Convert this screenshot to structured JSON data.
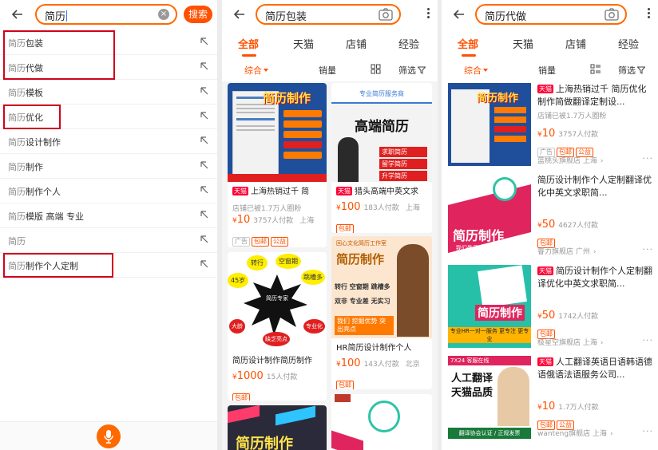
{
  "panel1": {
    "query": "简历",
    "search_button": "搜索",
    "clear_icon": "clear-icon",
    "suggestions": [
      {
        "prefix": "简历",
        "rest": "包装",
        "boxed": true
      },
      {
        "prefix": "简历",
        "rest": "代做",
        "boxed": true
      },
      {
        "prefix": "简历",
        "rest": "模板",
        "boxed": false
      },
      {
        "prefix": "简历",
        "rest": "优化",
        "boxed": true
      },
      {
        "prefix": "简历",
        "rest": "设计制作",
        "boxed": false
      },
      {
        "prefix": "简历",
        "rest": "制作",
        "boxed": false
      },
      {
        "prefix": "简历",
        "rest": "制作个人",
        "boxed": false
      },
      {
        "prefix": "简历",
        "rest": "模版 高端 专业",
        "boxed": false
      },
      {
        "prefix": "简历",
        "rest": "",
        "boxed": false
      },
      {
        "prefix": "简历",
        "rest": "制作个人定制",
        "boxed": true
      }
    ],
    "voice_icon": "microphone-icon"
  },
  "panel2": {
    "query": "简历包装",
    "tabs": [
      "全部",
      "天猫",
      "店铺",
      "经验"
    ],
    "filters": {
      "sort": "综合",
      "sales": "销量",
      "filter": "筛选"
    },
    "cards": [
      {
        "title": "上海热销过千 简",
        "tmall": "天猫",
        "sub": "店铺已被1.7万人圈粉",
        "price": "10",
        "paid": "3757人付款",
        "loc": "上海",
        "tags": [
          "广告",
          "包邮",
          "公益"
        ],
        "img_text": "简历制作"
      },
      {
        "title": "猎头高端中英文求",
        "tmall": "天猫",
        "sub": "",
        "price": "100",
        "paid": "183人付款",
        "loc": "上海",
        "tags": [
          "包邮"
        ],
        "img_text": "高端简历",
        "img_lines": [
          "求职简历",
          "留学简历",
          "升学简历"
        ],
        "img_top": "专业简历服务商"
      },
      {
        "title": "简历设计制作简历制作",
        "tmall": "",
        "sub": "",
        "price": "1000",
        "paid": "15人付款",
        "loc": "",
        "tags": [
          "包邮"
        ],
        "img_words": [
          "转行",
          "空窗期",
          "45岁",
          "跳槽多",
          "简历专家",
          "专业化",
          "大龄",
          "缺乏亮点"
        ]
      },
      {
        "title": "HR简历设计制作个人",
        "tmall": "",
        "sub": "",
        "price": "100",
        "paid": "143人付款",
        "loc": "北京",
        "tags": [
          "包邮"
        ],
        "img_text": "简历制作",
        "img_lines": [
          "转行 空窗期 跳槽多",
          "双非 专业差 无实习",
          "我们 挖掘优势 突出亮点"
        ],
        "img_top": "回心文化简历工作室"
      },
      {
        "title": "",
        "tmall": "",
        "sub": "",
        "price": "",
        "paid": "",
        "loc": "",
        "tags": [],
        "img_text": "简历制作"
      },
      {
        "title": "",
        "tmall": "",
        "sub": "",
        "price": "",
        "paid": "",
        "loc": "",
        "tags": [],
        "img_text": ""
      }
    ]
  },
  "panel3": {
    "query": "简历代做",
    "tabs": [
      "全部",
      "天猫",
      "店铺",
      "经验"
    ],
    "filters": {
      "sort": "综合",
      "sales": "销量",
      "filter": "筛选"
    },
    "rows": [
      {
        "tmall": "天猫",
        "title": "上海热销过千 简历优化制作简做翻译定制设...",
        "sub": "店铺已被1.7万人圈粉",
        "price": "10",
        "paid": "3757人付款",
        "tags": [
          "广告",
          "包邮",
          "公益"
        ],
        "shop": "蓝桃头旗舰店 上海",
        "img_text": "简历制作"
      },
      {
        "tmall": "",
        "title": "简历设计制作个人定制翻译优化中英文求职简...",
        "sub": "",
        "price": "50",
        "paid": "4627人付款",
        "tags": [
          "包邮"
        ],
        "shop": "睿力旗舰店 广州",
        "img_text": "简历制作",
        "img_sub": "我们骨子里是HR, 不是商人"
      },
      {
        "tmall": "天猫",
        "title": "简历设计制作个人定制翻译优化中英文求职简...",
        "sub": "",
        "price": "50",
        "paid": "1742人付款",
        "tags": [
          "包邮"
        ],
        "shop": "极星空旗舰店 上海",
        "img_text": "简历制作",
        "img_sub": "专业HR一对一服务 更专注 更专业"
      },
      {
        "tmall": "天猫",
        "title": "人工翻译英语日语韩语德语俄语法语服务公司...",
        "sub": "",
        "price": "10",
        "paid": "1.7万人付款",
        "tags": [
          "包邮",
          "公益"
        ],
        "shop": "wanteng旗舰店 上海",
        "img_text": "人工翻译 天猫品质",
        "img_top": "7X24 客服在线",
        "img_sub": "翻译协会认证 / 正规发票"
      }
    ]
  },
  "colors": {
    "brand": "#ff5000",
    "tmall": "#ff0036",
    "annotation": "#d0021b"
  }
}
